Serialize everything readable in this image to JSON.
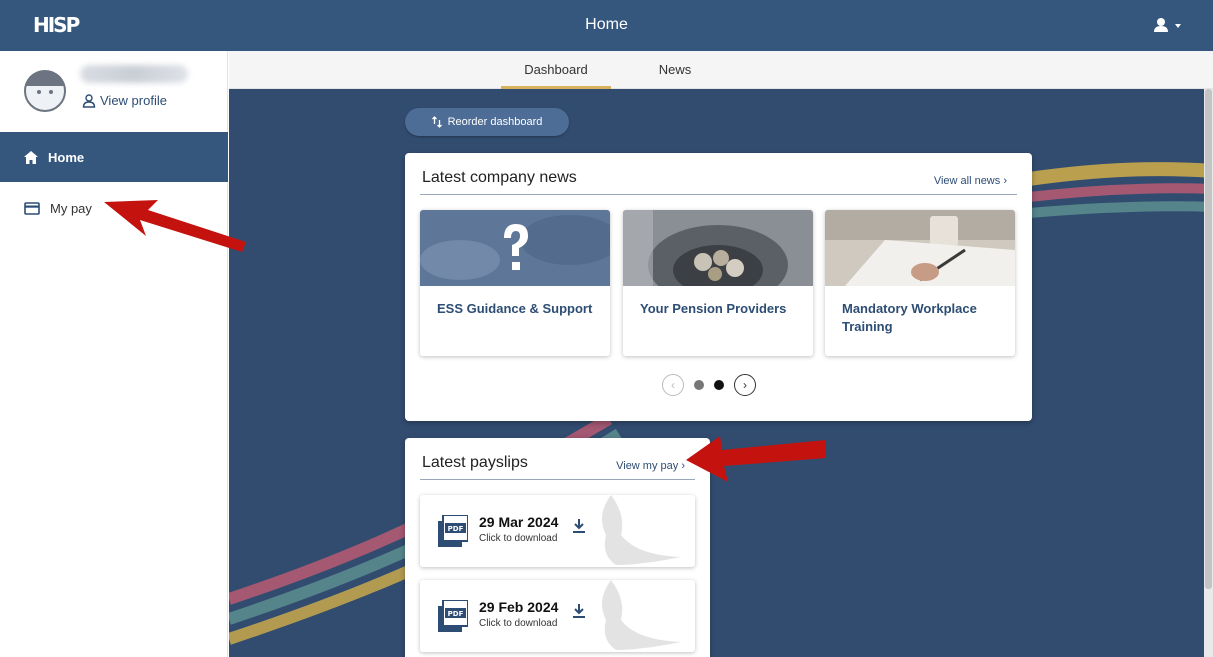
{
  "app": {
    "logo_text": "HISP",
    "title": "Home"
  },
  "user_menu": {
    "icon": "user-icon",
    "dropdown_icon": "caret-down-icon"
  },
  "sidebar": {
    "profile": {
      "view_profile": "View profile"
    },
    "items": [
      {
        "label": "Home",
        "icon": "home-icon",
        "active": true
      },
      {
        "label": "My pay",
        "icon": "card-icon",
        "active": false
      }
    ]
  },
  "tabs": [
    {
      "label": "Dashboard",
      "active": true
    },
    {
      "label": "News",
      "active": false
    }
  ],
  "dashboard": {
    "reorder_label": "Reorder dashboard",
    "news": {
      "title": "Latest company news",
      "link": "View all news",
      "items": [
        {
          "label": "ESS Guidance & Support"
        },
        {
          "label": "Your Pension Providers"
        },
        {
          "label": "Mandatory Workplace Training"
        }
      ],
      "carousel": {
        "pages": 2,
        "current": 2
      }
    },
    "payslips": {
      "title": "Latest payslips",
      "link": "View my pay",
      "items": [
        {
          "date": "29 Mar 2024",
          "sub": "Click to download"
        },
        {
          "date": "29 Feb 2024",
          "sub": "Click to download"
        }
      ]
    }
  },
  "colors": {
    "brand": "#35577e",
    "accent": "#d8b25d",
    "link": "#2d4d74",
    "annotation_arrow": "#c4120f"
  }
}
